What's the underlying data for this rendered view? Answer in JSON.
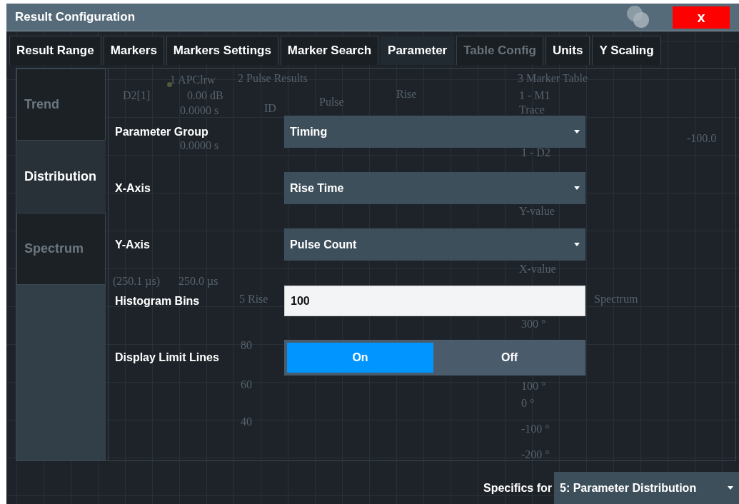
{
  "window": {
    "title": "Result Configuration",
    "close": "x"
  },
  "tabs": [
    {
      "label": "Result Range",
      "selected": false,
      "disabled": false
    },
    {
      "label": "Markers",
      "selected": false,
      "disabled": false
    },
    {
      "label": "Markers Settings",
      "selected": false,
      "disabled": false
    },
    {
      "label": "Marker Search",
      "selected": false,
      "disabled": false
    },
    {
      "label": "Parameter",
      "selected": true,
      "disabled": false
    },
    {
      "label": "Table Config",
      "selected": false,
      "disabled": true
    },
    {
      "label": "Units",
      "selected": false,
      "disabled": false
    },
    {
      "label": "Y Scaling",
      "selected": false,
      "disabled": false
    }
  ],
  "side_tabs": [
    {
      "label": "Trend",
      "selected": false
    },
    {
      "label": "Distribution",
      "selected": true
    },
    {
      "label": "Spectrum",
      "selected": false
    }
  ],
  "fields": [
    {
      "kind": "dropdown",
      "label": "Parameter Group",
      "value": "Timing"
    },
    {
      "kind": "dropdown",
      "label": "X-Axis",
      "value": "Rise Time"
    },
    {
      "kind": "dropdown",
      "label": "Y-Axis",
      "value": "Pulse Count"
    },
    {
      "kind": "input",
      "label": "Histogram Bins",
      "value": "100"
    },
    {
      "kind": "toggle",
      "label": "Display Limit Lines",
      "options": [
        {
          "label": "On",
          "selected": true
        },
        {
          "label": "Off",
          "selected": false
        }
      ]
    }
  ],
  "footer": {
    "label": "Specifics for",
    "value": "5: Parameter Distribution"
  },
  "background_display": {
    "texts": [
      "1 APClrw",
      "2 Pulse Results",
      "3 Marker Table",
      "D2[1]",
      "0.00 dB",
      "0.0000 s",
      "0.0000 s",
      "ID",
      "Pulse",
      "Rise",
      "1 - M1",
      "Trace",
      "-100.0",
      "1 - D2",
      "Y-value",
      "X-value",
      "(250.1 µs)",
      "250.0 µs",
      "5 Rise",
      "Spectrum",
      "80",
      "60",
      "40",
      "300 °",
      "100 °",
      "0 °",
      "-100 °",
      "-200 °"
    ]
  }
}
